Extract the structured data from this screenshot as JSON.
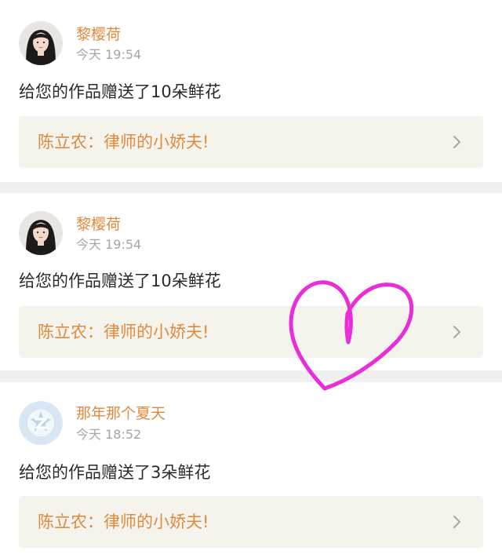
{
  "feed": [
    {
      "sender": "黎樱荷",
      "time": "今天 19:54",
      "message": "给您的作品赠送了10朵鲜花",
      "work_title": "陈立农：律师的小娇夫!",
      "avatar_icon": "user-photo-avatar"
    },
    {
      "sender": "黎樱荷",
      "time": "今天 19:54",
      "message": "给您的作品赠送了10朵鲜花",
      "work_title": "陈立农：律师的小娇夫!",
      "avatar_icon": "user-photo-avatar"
    },
    {
      "sender": "那年那个夏天",
      "time": "今天 18:52",
      "message": "给您的作品赠送了3朵鲜花",
      "work_title": "陈立农：律师的小娇夫!",
      "avatar_icon": "default-z-avatar"
    }
  ],
  "colors": {
    "accent": "#e08a3e",
    "time": "#a6a6a6",
    "link_bg": "#f5f4ec",
    "heart": "#e82ed6",
    "divider": "#f0f0f0"
  },
  "overlay": {
    "icon": "hand-drawn-heart"
  }
}
